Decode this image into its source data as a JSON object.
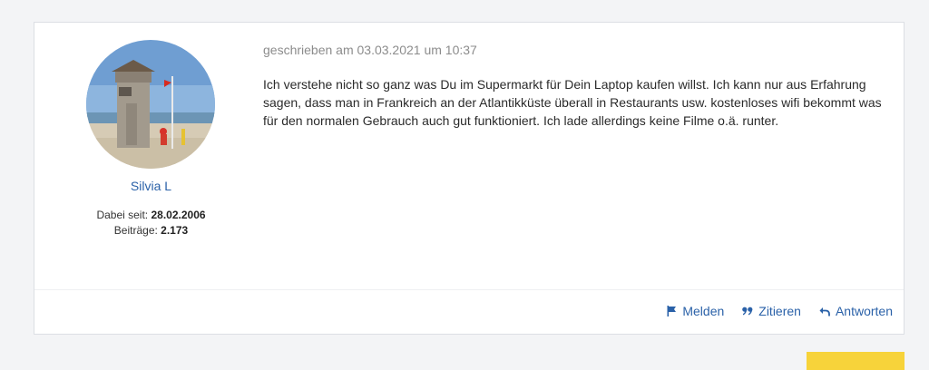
{
  "post": {
    "author": {
      "name": "Silvia L",
      "joined_label": "Dabei seit:",
      "joined_value": "28.02.2006",
      "posts_label": "Beiträge:",
      "posts_value": "2.173"
    },
    "date": "geschrieben am 03.03.2021 um 10:37",
    "body": "Ich verstehe nicht so ganz was Du im Supermarkt für Dein Laptop kaufen willst. Ich kann nur aus Erfahrung sagen, dass man in Frankreich an der Atlantikküste überall in Restaurants usw. kostenloses wifi bekommt was für den normalen Gebrauch auch gut funktioniert. Ich lade allerdings keine Filme o.ä. runter.",
    "actions": {
      "report_label": "Melden",
      "quote_label": "Zitieren",
      "reply_label": "Antworten"
    }
  },
  "icons": {
    "report": "flag-icon",
    "quote": "quote-icon",
    "reply": "reply-arrow-icon"
  },
  "colors": {
    "link": "#2a61a8",
    "accent_button": "#f7d33a"
  }
}
